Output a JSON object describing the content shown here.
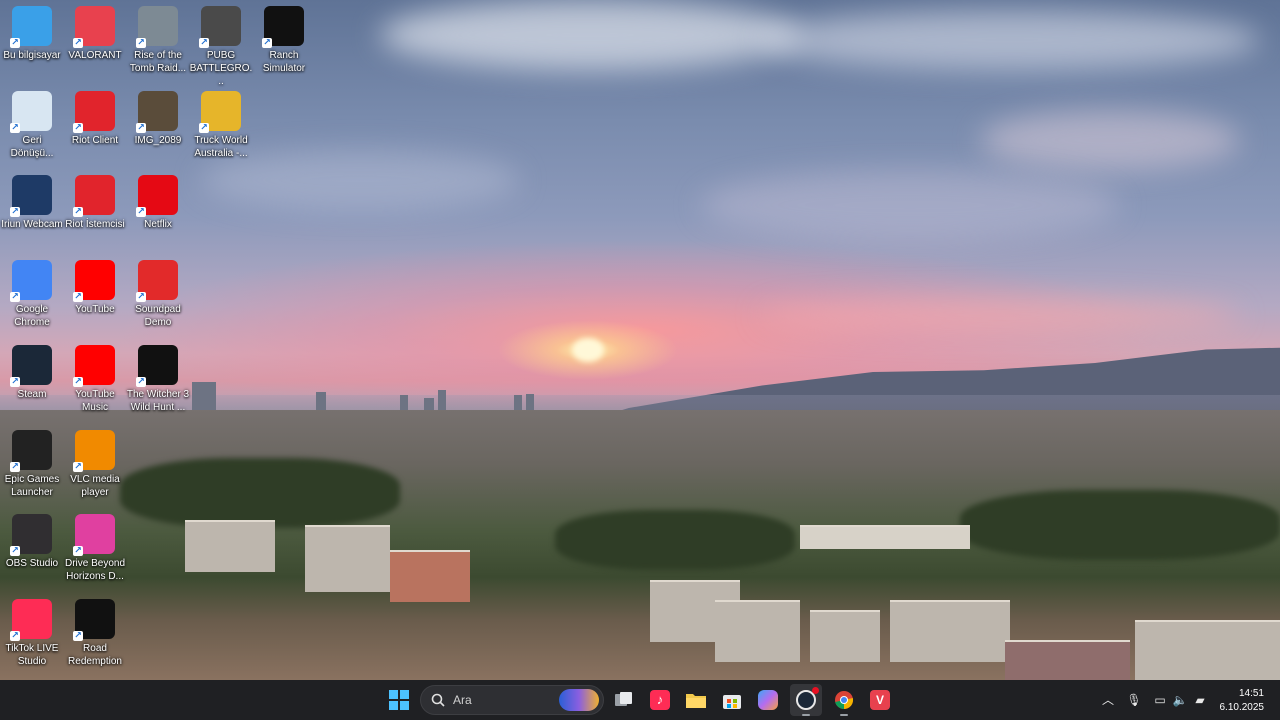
{
  "desktop": {
    "icons": [
      {
        "label": "Bu bilgisayar",
        "icon": "monitor-icon",
        "color": "#3aa0e8"
      },
      {
        "label": "VALORANT",
        "icon": "valorant-icon",
        "color": "#e8414e"
      },
      {
        "label": "Rise of the Tomb Raid...",
        "icon": "tomb-raider-icon",
        "color": "#7d8a94"
      },
      {
        "label": "PUBG BATTLEGRO...",
        "icon": "pubg-icon",
        "color": "#4a4a4a"
      },
      {
        "label": "Ranch Simulator",
        "icon": "ranch-simulator-icon",
        "color": "#111111"
      },
      {
        "label": "Geri Dönüşü...",
        "icon": "recycle-bin-icon",
        "color": "#d8e6f2"
      },
      {
        "label": "Riot Client",
        "icon": "riot-client-icon",
        "color": "#e1242c"
      },
      {
        "label": "IMG_2089",
        "icon": "image-thumbnail-icon",
        "color": "#5a4c3a"
      },
      {
        "label": "Truck World Australia -...",
        "icon": "truck-world-icon",
        "color": "#e6b52a"
      },
      {
        "label": "Iriun Webcam",
        "icon": "webcam-icon",
        "color": "#1e3a66"
      },
      {
        "label": "Riot İstemcisi",
        "icon": "riot-client-icon",
        "color": "#e1242c"
      },
      {
        "label": "Netflix",
        "icon": "netflix-icon",
        "color": "#e50914"
      },
      {
        "label": "Google Chrome",
        "icon": "chrome-icon",
        "color": "#4285f4"
      },
      {
        "label": "YouTube",
        "icon": "youtube-icon",
        "color": "#ff0000"
      },
      {
        "label": "Soundpad Demo",
        "icon": "soundpad-icon",
        "color": "#e22a2a"
      },
      {
        "label": "Steam",
        "icon": "steam-icon",
        "color": "#1b2838"
      },
      {
        "label": "YouTube Music",
        "icon": "youtube-music-icon",
        "color": "#ff0000"
      },
      {
        "label": "The Witcher 3 Wild Hunt ...",
        "icon": "witcher-icon",
        "color": "#111111"
      },
      {
        "label": "Epic Games Launcher",
        "icon": "epic-games-icon",
        "color": "#222222"
      },
      {
        "label": "VLC media player",
        "icon": "vlc-icon",
        "color": "#f18a00"
      },
      {
        "label": "OBS Studio",
        "icon": "obs-icon",
        "color": "#302e31"
      },
      {
        "label": "Drive Beyond Horizons D...",
        "icon": "drive-beyond-horizons-icon",
        "color": "#e040a0"
      },
      {
        "label": "TikTok LIVE Studio",
        "icon": "tiktok-live-icon",
        "color": "#fe2c55"
      },
      {
        "label": "Road Redemption",
        "icon": "road-redemption-icon",
        "color": "#111111"
      }
    ]
  },
  "taskbar": {
    "search_placeholder": "Ara",
    "apps": [
      {
        "name": "start-button",
        "icon": "windows-icon"
      },
      {
        "name": "task-view",
        "icon": "task-view-icon"
      },
      {
        "name": "tiktok",
        "icon": "tiktok-icon"
      },
      {
        "name": "file-explorer",
        "icon": "folder-icon"
      },
      {
        "name": "microsoft-store",
        "icon": "store-icon"
      },
      {
        "name": "copilot",
        "icon": "copilot-icon"
      },
      {
        "name": "steam-app",
        "icon": "steam-icon"
      },
      {
        "name": "chrome-app",
        "icon": "chrome-icon"
      },
      {
        "name": "valorant-app",
        "icon": "valorant-icon"
      }
    ],
    "clock": {
      "time": "14:51",
      "date": "6.10.2025"
    }
  }
}
